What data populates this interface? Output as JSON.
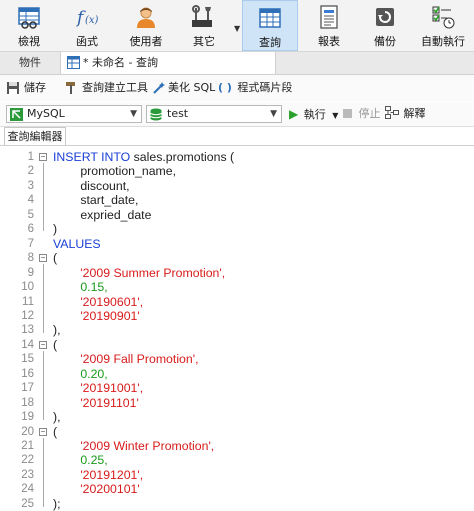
{
  "ribbon": {
    "items": [
      {
        "label": "檢視",
        "icon": "grid-view-icon"
      },
      {
        "label": "函式",
        "icon": "function-icon"
      },
      {
        "label": "使用者",
        "icon": "user-icon"
      },
      {
        "label": "其它",
        "icon": "tools-icon"
      },
      {
        "label": "查詢",
        "icon": "query-table-icon",
        "active": true
      },
      {
        "label": "報表",
        "icon": "report-icon"
      },
      {
        "label": "備份",
        "icon": "backup-icon"
      },
      {
        "label": "自動執行",
        "icon": "automation-icon"
      }
    ]
  },
  "tabs": {
    "objects": "物件",
    "query": "* 未命名 - 查詢"
  },
  "actions": {
    "save": "儲存",
    "builder": "查詢建立工具",
    "beautify": "美化 SQL",
    "snippet": "程式碼片段"
  },
  "connection": {
    "db_type": "MySQL",
    "database": "test",
    "run": "執行",
    "stop": "停止",
    "explain": "解釋"
  },
  "editor_tab": "查詢編輯器",
  "colors": {
    "keyword": "#1a3fd6",
    "string": "#d81b1b",
    "number": "#1a9a1a",
    "active_tab": "#cfe4f7"
  },
  "code_lines": [
    {
      "n": "1",
      "fold": "−",
      "parts": [
        {
          "t": "INSERT INTO ",
          "c": "kw"
        },
        {
          "t": "sales.promotions (",
          "c": "plain"
        }
      ]
    },
    {
      "n": "2",
      "parts": [
        {
          "t": "        promotion_name,",
          "c": "plain"
        }
      ]
    },
    {
      "n": "3",
      "parts": [
        {
          "t": "        discount,",
          "c": "plain"
        }
      ]
    },
    {
      "n": "4",
      "parts": [
        {
          "t": "        start_date,",
          "c": "plain"
        }
      ]
    },
    {
      "n": "5",
      "parts": [
        {
          "t": "        expried_date",
          "c": "plain"
        }
      ]
    },
    {
      "n": "6",
      "parts": [
        {
          "t": ")",
          "c": "plain"
        }
      ]
    },
    {
      "n": "7",
      "parts": [
        {
          "t": "VALUES",
          "c": "kw"
        }
      ]
    },
    {
      "n": "8",
      "fold": "−",
      "parts": [
        {
          "t": "(",
          "c": "plain"
        }
      ]
    },
    {
      "n": "9",
      "parts": [
        {
          "t": "        '2009 Summer Promotion',",
          "c": "str"
        }
      ]
    },
    {
      "n": "10",
      "parts": [
        {
          "t": "        0.15,",
          "c": "num"
        }
      ]
    },
    {
      "n": "11",
      "parts": [
        {
          "t": "        '20190601',",
          "c": "str"
        }
      ]
    },
    {
      "n": "12",
      "parts": [
        {
          "t": "        '20190901'",
          "c": "str"
        }
      ]
    },
    {
      "n": "13",
      "parts": [
        {
          "t": "),",
          "c": "plain"
        }
      ]
    },
    {
      "n": "14",
      "fold": "−",
      "parts": [
        {
          "t": "(",
          "c": "plain"
        }
      ]
    },
    {
      "n": "15",
      "parts": [
        {
          "t": "        '2009 Fall Promotion',",
          "c": "str"
        }
      ]
    },
    {
      "n": "16",
      "parts": [
        {
          "t": "        0.20,",
          "c": "num"
        }
      ]
    },
    {
      "n": "17",
      "parts": [
        {
          "t": "        '20191001',",
          "c": "str"
        }
      ]
    },
    {
      "n": "18",
      "parts": [
        {
          "t": "        '20191101'",
          "c": "str"
        }
      ]
    },
    {
      "n": "19",
      "parts": [
        {
          "t": "),",
          "c": "plain"
        }
      ]
    },
    {
      "n": "20",
      "fold": "−",
      "parts": [
        {
          "t": "(",
          "c": "plain"
        }
      ]
    },
    {
      "n": "21",
      "parts": [
        {
          "t": "        '2009 Winter Promotion',",
          "c": "str"
        }
      ]
    },
    {
      "n": "22",
      "parts": [
        {
          "t": "        0.25,",
          "c": "num"
        }
      ]
    },
    {
      "n": "23",
      "parts": [
        {
          "t": "        '20191201',",
          "c": "str"
        }
      ]
    },
    {
      "n": "24",
      "parts": [
        {
          "t": "        '20200101'",
          "c": "str"
        }
      ]
    },
    {
      "n": "25",
      "parts": [
        {
          "t": ");",
          "c": "plain"
        }
      ]
    }
  ]
}
